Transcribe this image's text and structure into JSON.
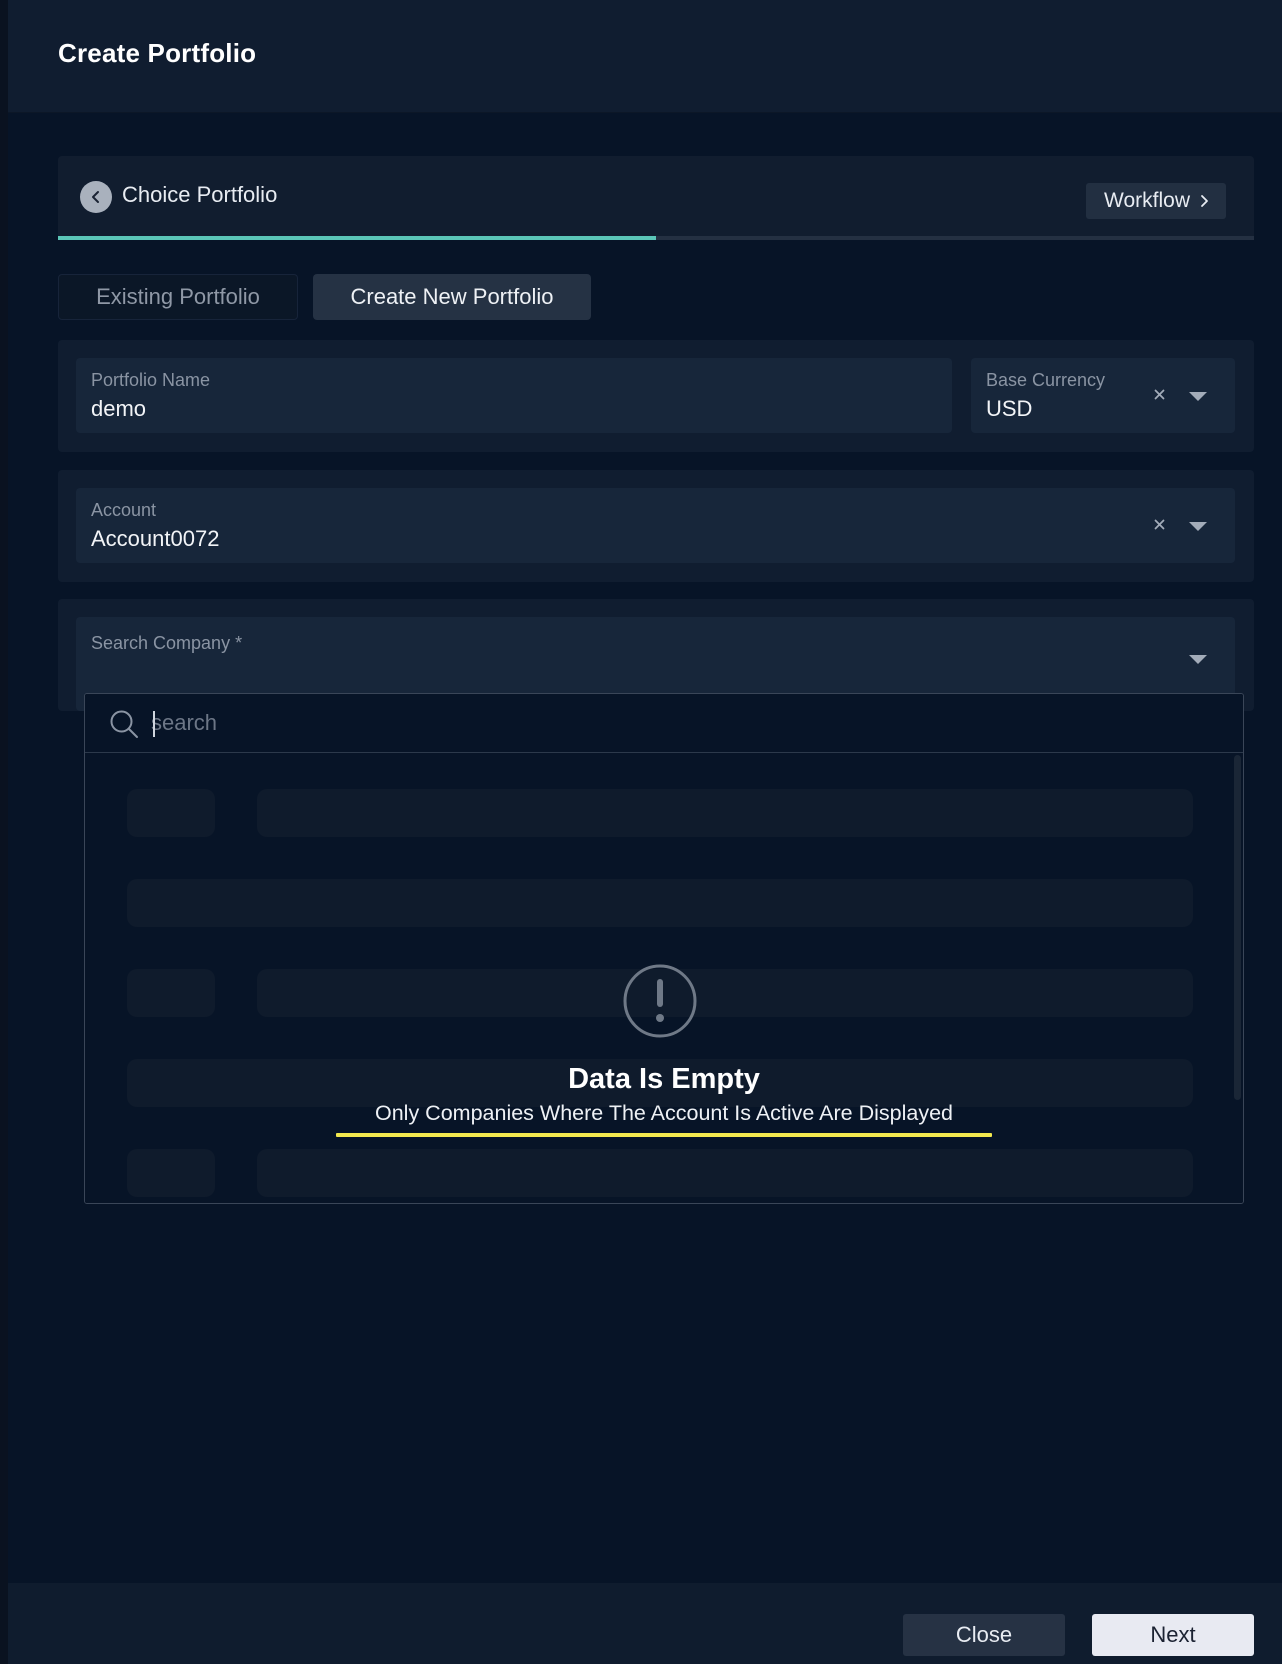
{
  "modal": {
    "title": "Create Portfolio"
  },
  "stepper": {
    "title": "Choice Portfolio",
    "workflow_label": "Workflow",
    "progress_percent": 50
  },
  "tabs": [
    {
      "label": "Existing Portfolio",
      "active": false
    },
    {
      "label": "Create New Portfolio",
      "active": true
    }
  ],
  "form": {
    "portfolio_name": {
      "label": "Portfolio Name",
      "value": "demo"
    },
    "base_currency": {
      "label": "Base Currency",
      "value": "USD"
    },
    "account": {
      "label": "Account",
      "value": "Account0072"
    },
    "search_company": {
      "label": "Search Company *"
    }
  },
  "dropdown": {
    "search_placeholder": "search",
    "empty_title": "Data Is Empty",
    "empty_message": "Only Companies Where The Account Is Active Are Displayed"
  },
  "footer": {
    "close_label": "Close",
    "next_label": "Next"
  },
  "colors": {
    "accent": "#5bc6b8",
    "highlight": "#f2e94e",
    "background": "#071427"
  }
}
